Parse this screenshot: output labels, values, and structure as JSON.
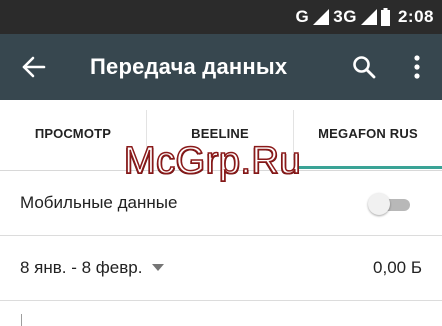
{
  "status_bar": {
    "network_letter": "G",
    "network_type": "3G",
    "time": "2:08",
    "icons": [
      "signal-icon",
      "signal-icon",
      "battery-icon"
    ]
  },
  "toolbar": {
    "title": "Передача данных",
    "icons": [
      "back-arrow-icon",
      "search-icon",
      "more-vert-icon"
    ],
    "background": "#37474f"
  },
  "tabs": {
    "items": [
      {
        "label": "ПРОСМОТР"
      },
      {
        "label": "BEELINE"
      },
      {
        "label": "MEGAFON RUS"
      }
    ],
    "selected_index": 2,
    "indicator_color": "#3aa396"
  },
  "watermark": {
    "text": "McGrp.Ru"
  },
  "mobile_data": {
    "label": "Мобильные данные",
    "enabled": false
  },
  "period": {
    "range": "8 янв. - 8 февр.",
    "usage": "0,00 Б",
    "icon": "dropdown-triangle-icon"
  }
}
